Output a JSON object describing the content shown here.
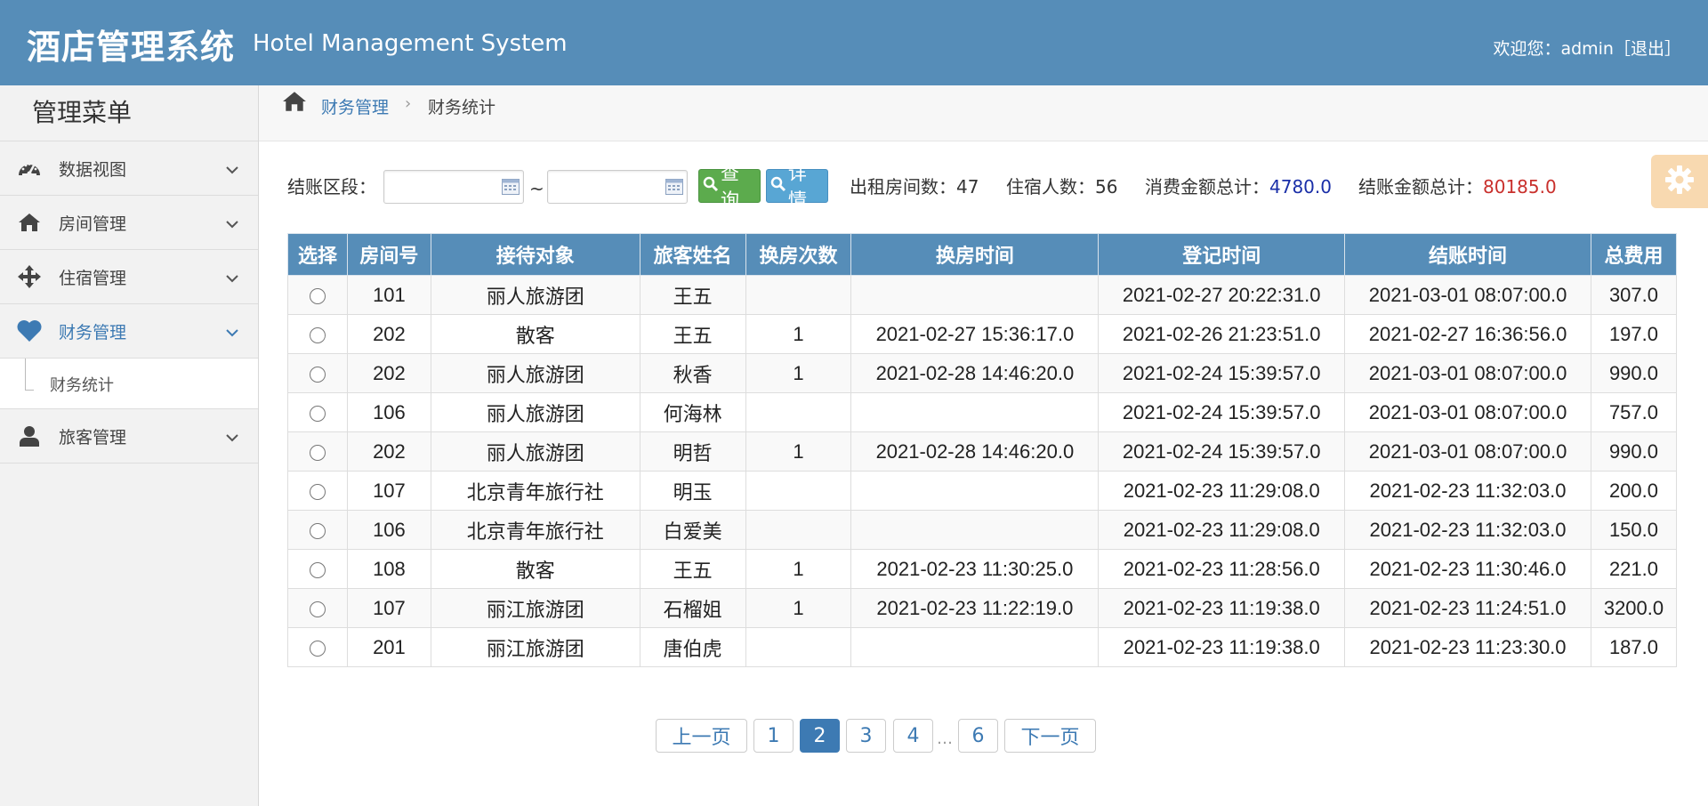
{
  "header": {
    "title_cn": "酒店管理系统",
    "title_en": "Hotel Management System",
    "welcome": "欢迎您：admin",
    "logout": "［退出］"
  },
  "sidebar": {
    "menu_title": "管理菜单",
    "items": [
      {
        "label": "数据视图",
        "icon": "dashboard-icon"
      },
      {
        "label": "房间管理",
        "icon": "home-icon"
      },
      {
        "label": "住宿管理",
        "icon": "move-icon"
      },
      {
        "label": "财务管理",
        "icon": "heart-icon",
        "active": true
      },
      {
        "label": "旅客管理",
        "icon": "user-icon"
      }
    ],
    "sub_item": "财务统计"
  },
  "breadcrumb": {
    "level1": "财务管理",
    "separator": "›",
    "level2": "财务统计"
  },
  "filter": {
    "label": "结账区段：",
    "start_date": "",
    "end_date": "",
    "tilde": "~",
    "query_button": "查询",
    "detail_button": "详情",
    "rooms_label": "出租房间数：",
    "rooms_value": "47",
    "guests_label": "住宿人数：",
    "guests_value": "56",
    "consume_label": "消费金额总计：",
    "consume_value": "4780.0",
    "settle_label": "结账金额总计：",
    "settle_value": "80185.0"
  },
  "table": {
    "headers": [
      "选择",
      "房间号",
      "接待对象",
      "旅客姓名",
      "换房次数",
      "换房时间",
      "登记时间",
      "结账时间",
      "总费用"
    ],
    "rows": [
      [
        "101",
        "丽人旅游团",
        "王五",
        "",
        "",
        "2021-02-27 20:22:31.0",
        "2021-03-01 08:07:00.0",
        "307.0"
      ],
      [
        "202",
        "散客",
        "王五",
        "1",
        "2021-02-27 15:36:17.0",
        "2021-02-26 21:23:51.0",
        "2021-02-27 16:36:56.0",
        "197.0"
      ],
      [
        "202",
        "丽人旅游团",
        "秋香",
        "1",
        "2021-02-28 14:46:20.0",
        "2021-02-24 15:39:57.0",
        "2021-03-01 08:07:00.0",
        "990.0"
      ],
      [
        "106",
        "丽人旅游团",
        "何海林",
        "",
        "",
        "2021-02-24 15:39:57.0",
        "2021-03-01 08:07:00.0",
        "757.0"
      ],
      [
        "202",
        "丽人旅游团",
        "明哲",
        "1",
        "2021-02-28 14:46:20.0",
        "2021-02-24 15:39:57.0",
        "2021-03-01 08:07:00.0",
        "990.0"
      ],
      [
        "107",
        "北京青年旅行社",
        "明玉",
        "",
        "",
        "2021-02-23 11:29:08.0",
        "2021-02-23 11:32:03.0",
        "200.0"
      ],
      [
        "106",
        "北京青年旅行社",
        "白爱美",
        "",
        "",
        "2021-02-23 11:29:08.0",
        "2021-02-23 11:32:03.0",
        "150.0"
      ],
      [
        "108",
        "散客",
        "王五",
        "1",
        "2021-02-23 11:30:25.0",
        "2021-02-23 11:28:56.0",
        "2021-02-23 11:30:46.0",
        "221.0"
      ],
      [
        "107",
        "丽江旅游团",
        "石榴姐",
        "1",
        "2021-02-23 11:22:19.0",
        "2021-02-23 11:19:38.0",
        "2021-02-23 11:24:51.0",
        "3200.0"
      ],
      [
        "201",
        "丽江旅游团",
        "唐伯虎",
        "",
        "",
        "2021-02-23 11:19:38.0",
        "2021-02-23 11:23:30.0",
        "187.0"
      ]
    ]
  },
  "pagination": {
    "prev": "上一页",
    "pages": [
      "1",
      "2",
      "3",
      "4"
    ],
    "ellipsis": "…",
    "last": "6",
    "next": "下一页",
    "current": "2"
  },
  "colors": {
    "header_bg": "#568db8",
    "accent": "#3d7ab3",
    "query_green": "#5cab4d",
    "detail_blue": "#58a6d4",
    "consume_blue": "#1a2fa8",
    "settle_red": "#c9302c"
  }
}
